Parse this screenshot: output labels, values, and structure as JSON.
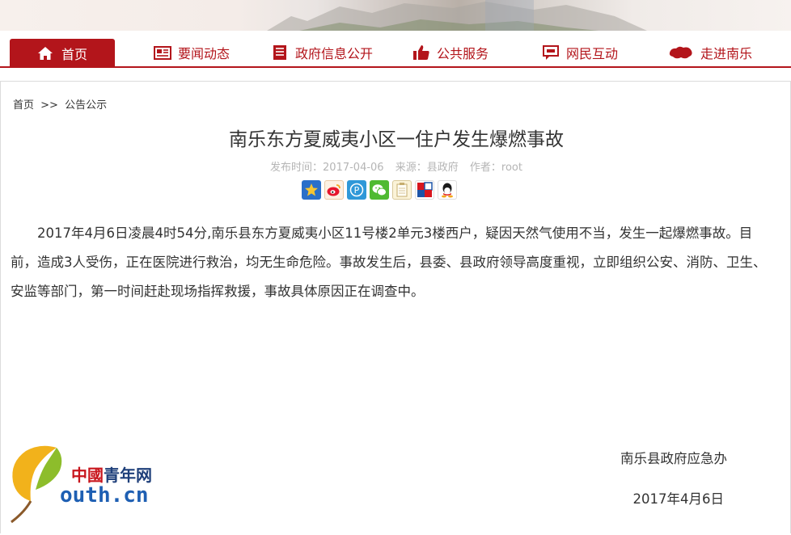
{
  "nav": {
    "home": "首页",
    "items": [
      {
        "label": "要闻动态",
        "icon": "newspaper-icon"
      },
      {
        "label": "政府信息公开",
        "icon": "document-icon"
      },
      {
        "label": "公共服务",
        "icon": "thumbs-up-icon"
      },
      {
        "label": "网民互动",
        "icon": "chat-icon"
      },
      {
        "label": "走进南乐",
        "icon": "map-icon"
      }
    ],
    "accent_color": "#b3151b"
  },
  "breadcrumb": {
    "home": "首页",
    "sep": ">>",
    "current": "公告公示"
  },
  "article": {
    "title": "南乐东方夏威夷小区一住户发生爆燃事故",
    "publish_time": "发布时间：2017-04-06",
    "source": "来源：县政府",
    "author": "作者：root",
    "body": "2017年4月6日凌晨4时54分,南乐县东方夏威夷小区11号楼2单元3楼西户，疑因天然气使用不当，发生一起爆燃事故。目前，造成3人受伤，正在医院进行救治，均无生命危险。事故发生后，县委、县政府领导高度重视，立即组织公安、消防、卫生、安监等部门，第一时间赶赴现场指挥救援，事故具体原因正在调查中。",
    "signature": "南乐县政府应急办",
    "date": "2017年4月6日"
  },
  "share_icons": [
    "favorite-star-icon",
    "weibo-icon",
    "pinterest-icon",
    "wechat-icon",
    "notepad-icon",
    "renren-icon",
    "qq-icon"
  ],
  "watermark": {
    "brand_cn": "中國青年网",
    "brand_en": "outh.cn"
  }
}
